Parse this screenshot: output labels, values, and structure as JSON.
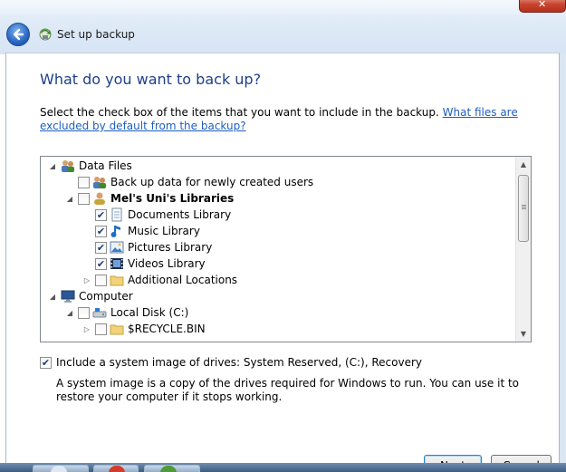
{
  "window": {
    "title": "Set up backup",
    "close_glyph": "✕"
  },
  "page": {
    "heading": "What do you want to back up?",
    "instruction": "Select the check box of the items that you want to include in the backup.",
    "help_link": "What files are excluded by default from the backup?"
  },
  "tree": {
    "items": [
      {
        "label": "Data Files",
        "expander": "expanded",
        "checkbox": "none",
        "icon": "users-icon"
      },
      {
        "label": "Back up data for newly created users",
        "expander": "none",
        "checkbox": "unchecked",
        "icon": "users-icon"
      },
      {
        "label": "Mel's Uni's Libraries",
        "expander": "expanded",
        "checkbox": "unchecked",
        "icon": "user-icon"
      },
      {
        "label": "Documents Library",
        "expander": "none",
        "checkbox": "checked",
        "icon": "documents-library-icon"
      },
      {
        "label": "Music Library",
        "expander": "none",
        "checkbox": "checked",
        "icon": "music-library-icon"
      },
      {
        "label": "Pictures Library",
        "expander": "none",
        "checkbox": "checked",
        "icon": "pictures-library-icon"
      },
      {
        "label": "Videos Library",
        "expander": "none",
        "checkbox": "checked",
        "icon": "videos-library-icon"
      },
      {
        "label": "Additional Locations",
        "expander": "collapsed",
        "checkbox": "unchecked",
        "icon": "folder-icon"
      },
      {
        "label": "Computer",
        "expander": "expanded",
        "checkbox": "none",
        "icon": "computer-icon"
      },
      {
        "label": "Local Disk (C:)",
        "expander": "expanded",
        "checkbox": "unchecked",
        "icon": "disk-icon"
      },
      {
        "label": "$RECYCLE.BIN",
        "expander": "collapsed",
        "checkbox": "unchecked",
        "icon": "folder-icon"
      }
    ]
  },
  "system_image": {
    "checked": true,
    "label": "Include a system image of drives: System Reserved, (C:), Recovery",
    "description": "A system image is a copy of the drives required for Windows to run. You can use it to restore your computer if it stops working."
  },
  "buttons": {
    "next": "Next",
    "cancel": "Cancel"
  },
  "colors": {
    "heading": "#1e3f8a",
    "link": "#1f5fbf",
    "check": "#1b3d7a"
  }
}
